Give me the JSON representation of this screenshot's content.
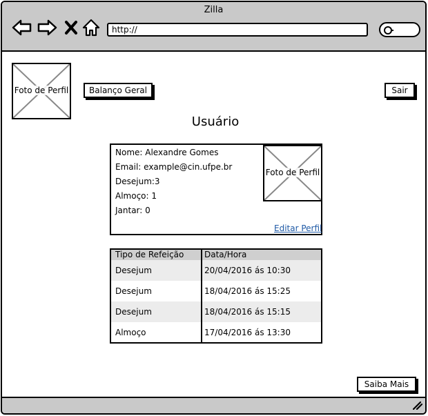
{
  "window": {
    "title": "Zilla"
  },
  "browser": {
    "url": "http://",
    "icons": [
      "back-icon",
      "forward-icon",
      "close-icon",
      "home-icon",
      "search-icon",
      "resize-grip-icon"
    ]
  },
  "header": {
    "profile_image_label": "Foto de Perfil",
    "balance_button": "Balanço Geral",
    "logout_button": "Sair"
  },
  "main": {
    "title": "Usuário",
    "profile": {
      "name_line": "Nome: Alexandre Gomes",
      "email_line": "Email: example@cin.ufpe.br",
      "breakfast_line": "Desejum:3",
      "lunch_line": "Almoço: 1",
      "dinner_line": "Jantar: 0",
      "image_label": "Foto de Perfil",
      "edit_link": "Editar Perfil"
    },
    "meals_table": {
      "headers": [
        "Tipo de Refeição",
        "Data/Hora"
      ],
      "rows": [
        {
          "type": "Desejum",
          "datetime": "20/04/2016 ás 10:30"
        },
        {
          "type": "Desejum",
          "datetime": "18/04/2016 ás 15:25"
        },
        {
          "type": "Desejum",
          "datetime": "18/04/2016 ás 15:15"
        },
        {
          "type": "Almoço",
          "datetime": "17/04/2016 ás 13:30"
        }
      ]
    },
    "more_button": "Saiba Mais"
  }
}
